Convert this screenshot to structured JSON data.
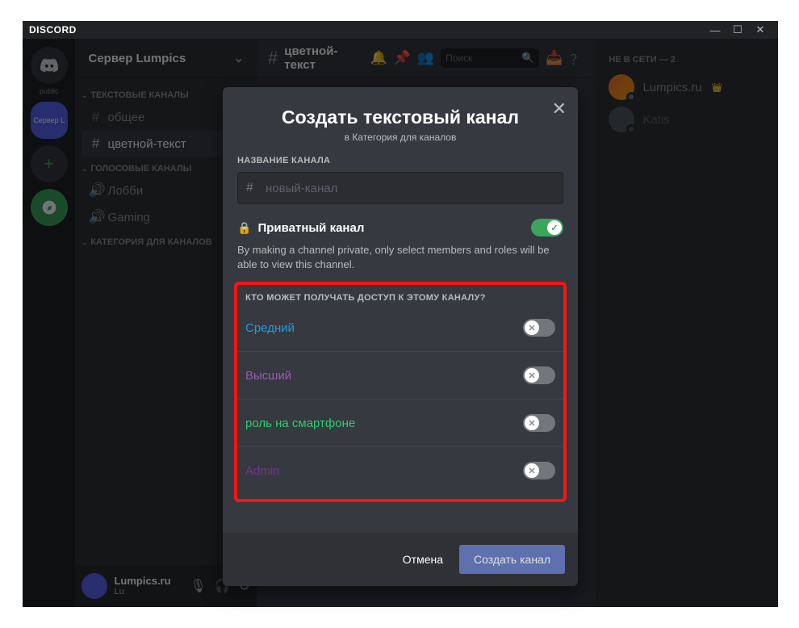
{
  "app_name": "DISCORD",
  "server": {
    "name": "Сервер Lumpics"
  },
  "guild_public_label": "public",
  "guild_purple_label": "Сервер L",
  "categories": {
    "text": "ТЕКСТОВЫЕ КАНАЛЫ",
    "voice": "ГОЛОСОВЫЕ КАНАЛЫ",
    "custom": "КАТЕГОРИЯ ДЛЯ КАНАЛОВ"
  },
  "channels": {
    "text": [
      {
        "name": "общее"
      },
      {
        "name": "цветной-текст"
      }
    ],
    "voice": [
      {
        "name": "Лобби"
      },
      {
        "name": "Gaming"
      }
    ]
  },
  "current_channel": "цветной-текст",
  "search_placeholder": "Поиск",
  "members": {
    "header": "НЕ В СЕТИ — 2",
    "list": [
      {
        "name": "Lumpics.ru",
        "owner": true
      },
      {
        "name": "Katis"
      }
    ]
  },
  "user": {
    "name": "Lumpics.ru",
    "tag": "Lu"
  },
  "modal": {
    "title": "Создать текстовый канал",
    "subtitle": "в Категория для каналов",
    "name_label": "НАЗВАНИЕ КАНАЛА",
    "name_placeholder": "новый-канал",
    "private_label": "Приватный канал",
    "private_desc": "By making a channel private, only select members and roles will be able to view this channel.",
    "access_label": "КТО МОЖЕТ ПОЛУЧАТЬ ДОСТУП К ЭТОМУ КАНАЛУ?",
    "roles": [
      {
        "name": "Средний",
        "color": "#1d9de3"
      },
      {
        "name": "Высший",
        "color": "#9b59b6"
      },
      {
        "name": "роль на смартфоне",
        "color": "#2ecc71"
      },
      {
        "name": "Admin",
        "color": "#71368a"
      }
    ],
    "cancel": "Отмена",
    "create": "Создать канал"
  }
}
